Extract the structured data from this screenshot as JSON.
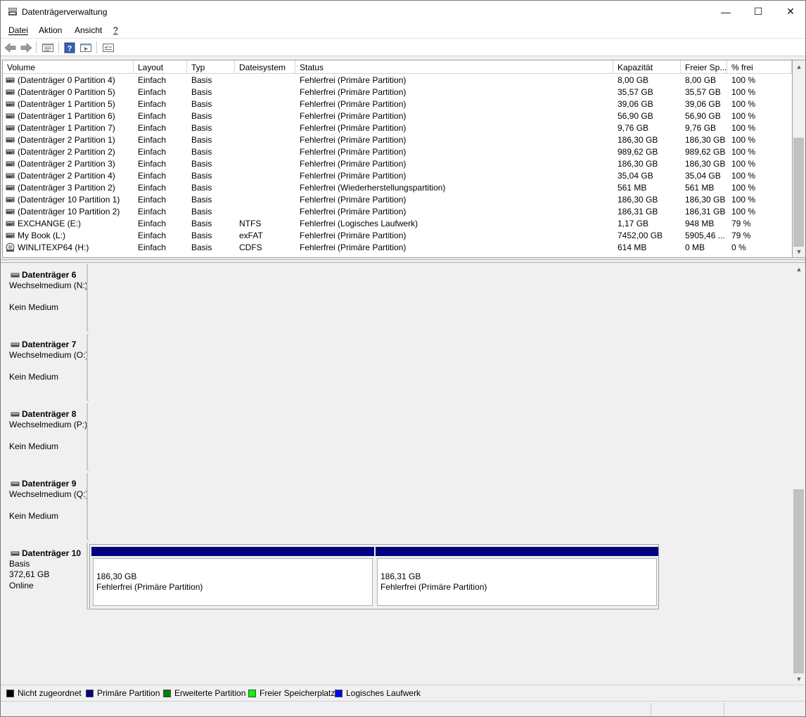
{
  "window": {
    "title": "Datenträgerverwaltung",
    "minimize_glyph": "—",
    "maximize_glyph": "☐",
    "close_glyph": "✕"
  },
  "menu": [
    "Datei",
    "Aktion",
    "Ansicht",
    "?"
  ],
  "toolbar": {
    "icons": [
      "back-arrow-icon",
      "forward-arrow-icon",
      "properties-list-icon",
      "help-icon",
      "refresh-view-icon",
      "settings-list-icon"
    ]
  },
  "volume_table": {
    "columns": [
      "Volume",
      "Layout",
      "Typ",
      "Dateisystem",
      "Status",
      "Kapazität",
      "Freier Sp...",
      "% frei"
    ],
    "rows": [
      {
        "volume": "(Datenträger 0 Partition 4)",
        "layout": "Einfach",
        "typ": "Basis",
        "fs": "",
        "status": "Fehlerfrei (Primäre Partition)",
        "capacity": "8,00 GB",
        "free": "8,00 GB",
        "pct": "100 %",
        "icon": "disk-icon"
      },
      {
        "volume": "(Datenträger 0 Partition 5)",
        "layout": "Einfach",
        "typ": "Basis",
        "fs": "",
        "status": "Fehlerfrei (Primäre Partition)",
        "capacity": "35,57 GB",
        "free": "35,57 GB",
        "pct": "100 %",
        "icon": "disk-icon"
      },
      {
        "volume": "(Datenträger 1 Partition 5)",
        "layout": "Einfach",
        "typ": "Basis",
        "fs": "",
        "status": "Fehlerfrei (Primäre Partition)",
        "capacity": "39,06 GB",
        "free": "39,06 GB",
        "pct": "100 %",
        "icon": "disk-icon"
      },
      {
        "volume": "(Datenträger 1 Partition 6)",
        "layout": "Einfach",
        "typ": "Basis",
        "fs": "",
        "status": "Fehlerfrei (Primäre Partition)",
        "capacity": "56,90 GB",
        "free": "56,90 GB",
        "pct": "100 %",
        "icon": "disk-icon"
      },
      {
        "volume": "(Datenträger 1 Partition 7)",
        "layout": "Einfach",
        "typ": "Basis",
        "fs": "",
        "status": "Fehlerfrei (Primäre Partition)",
        "capacity": "9,76 GB",
        "free": "9,76 GB",
        "pct": "100 %",
        "icon": "disk-icon"
      },
      {
        "volume": "(Datenträger 2 Partition 1)",
        "layout": "Einfach",
        "typ": "Basis",
        "fs": "",
        "status": "Fehlerfrei (Primäre Partition)",
        "capacity": "186,30 GB",
        "free": "186,30 GB",
        "pct": "100 %",
        "icon": "disk-icon"
      },
      {
        "volume": "(Datenträger 2 Partition 2)",
        "layout": "Einfach",
        "typ": "Basis",
        "fs": "",
        "status": "Fehlerfrei (Primäre Partition)",
        "capacity": "989,62 GB",
        "free": "989,62 GB",
        "pct": "100 %",
        "icon": "disk-icon"
      },
      {
        "volume": "(Datenträger 2 Partition 3)",
        "layout": "Einfach",
        "typ": "Basis",
        "fs": "",
        "status": "Fehlerfrei (Primäre Partition)",
        "capacity": "186,30 GB",
        "free": "186,30 GB",
        "pct": "100 %",
        "icon": "disk-icon"
      },
      {
        "volume": "(Datenträger 2 Partition 4)",
        "layout": "Einfach",
        "typ": "Basis",
        "fs": "",
        "status": "Fehlerfrei (Primäre Partition)",
        "capacity": "35,04 GB",
        "free": "35,04 GB",
        "pct": "100 %",
        "icon": "disk-icon"
      },
      {
        "volume": "(Datenträger 3 Partition 2)",
        "layout": "Einfach",
        "typ": "Basis",
        "fs": "",
        "status": "Fehlerfrei (Wiederherstellungspartition)",
        "capacity": "561 MB",
        "free": "561 MB",
        "pct": "100 %",
        "icon": "disk-icon"
      },
      {
        "volume": "(Datenträger 10 Partition 1)",
        "layout": "Einfach",
        "typ": "Basis",
        "fs": "",
        "status": "Fehlerfrei (Primäre Partition)",
        "capacity": "186,30 GB",
        "free": "186,30 GB",
        "pct": "100 %",
        "icon": "disk-icon"
      },
      {
        "volume": "(Datenträger 10 Partition 2)",
        "layout": "Einfach",
        "typ": "Basis",
        "fs": "",
        "status": "Fehlerfrei (Primäre Partition)",
        "capacity": "186,31 GB",
        "free": "186,31 GB",
        "pct": "100 %",
        "icon": "disk-icon"
      },
      {
        "volume": "EXCHANGE (E:)",
        "layout": "Einfach",
        "typ": "Basis",
        "fs": "NTFS",
        "status": "Fehlerfrei (Logisches Laufwerk)",
        "capacity": "1,17 GB",
        "free": "948 MB",
        "pct": "79 %",
        "icon": "disk-icon"
      },
      {
        "volume": "My Book (L:)",
        "layout": "Einfach",
        "typ": "Basis",
        "fs": "exFAT",
        "status": "Fehlerfrei (Primäre Partition)",
        "capacity": "7452,00 GB",
        "free": "5905,46 ...",
        "pct": "79 %",
        "icon": "disk-icon"
      },
      {
        "volume": "WINLITEXP64 (H:)",
        "layout": "Einfach",
        "typ": "Basis",
        "fs": "CDFS",
        "status": "Fehlerfrei (Primäre Partition)",
        "capacity": "614 MB",
        "free": "0 MB",
        "pct": "0 %",
        "icon": "cd-drive-icon"
      }
    ]
  },
  "disks": [
    {
      "name": "Datenträger 6",
      "line1": "Wechselmedium (N:)",
      "line2": "",
      "line3": "Kein Medium",
      "partitions": []
    },
    {
      "name": "Datenträger 7",
      "line1": "Wechselmedium (O:)",
      "line2": "",
      "line3": "Kein Medium",
      "partitions": []
    },
    {
      "name": "Datenträger 8",
      "line1": "Wechselmedium (P:)",
      "line2": "",
      "line3": "Kein Medium",
      "partitions": []
    },
    {
      "name": "Datenträger 9",
      "line1": "Wechselmedium (Q:)",
      "line2": "",
      "line3": "Kein Medium",
      "partitions": []
    },
    {
      "name": "Datenträger 10",
      "line1": "Basis",
      "line2": "372,61 GB",
      "line3": "Online",
      "partitions": [
        {
          "size": "186,30 GB",
          "status": "Fehlerfrei (Primäre Partition)"
        },
        {
          "size": "186,31 GB",
          "status": "Fehlerfrei (Primäre Partition)"
        }
      ]
    }
  ],
  "legend": [
    {
      "label": "Nicht zugeordnet",
      "color": "#000000"
    },
    {
      "label": "Primäre Partition",
      "color": "#000080"
    },
    {
      "label": "Erweiterte Partition",
      "color": "#008000"
    },
    {
      "label": "Freier Speicherplatz",
      "color": "#00ff00"
    },
    {
      "label": "Logisches Laufwerk",
      "color": "#0000ff"
    }
  ],
  "colors": {
    "primary_partition": "#000080"
  }
}
